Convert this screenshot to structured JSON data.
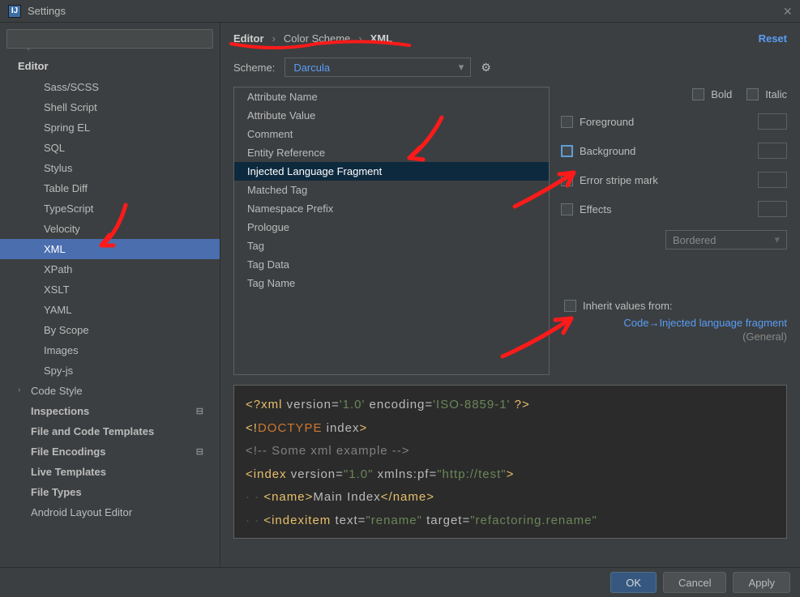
{
  "window": {
    "title": "Settings"
  },
  "search": {
    "placeholder": ""
  },
  "sidebar": {
    "header": "Editor",
    "items": [
      {
        "label": "Sass/SCSS",
        "level": 2
      },
      {
        "label": "Shell Script",
        "level": 2
      },
      {
        "label": "Spring EL",
        "level": 2
      },
      {
        "label": "SQL",
        "level": 2
      },
      {
        "label": "Stylus",
        "level": 2
      },
      {
        "label": "Table Diff",
        "level": 2
      },
      {
        "label": "TypeScript",
        "level": 2
      },
      {
        "label": "Velocity",
        "level": 2
      },
      {
        "label": "XML",
        "level": 2,
        "selected": true
      },
      {
        "label": "XPath",
        "level": 2
      },
      {
        "label": "XSLT",
        "level": 2
      },
      {
        "label": "YAML",
        "level": 2
      },
      {
        "label": "By Scope",
        "level": 2
      },
      {
        "label": "Images",
        "level": 2
      },
      {
        "label": "Spy-js",
        "level": 2
      },
      {
        "label": "Code Style",
        "level": 1,
        "chevron": true
      },
      {
        "label": "Inspections",
        "level": 1,
        "bold": true,
        "gear": true
      },
      {
        "label": "File and Code Templates",
        "level": 1,
        "bold": true
      },
      {
        "label": "File Encodings",
        "level": 1,
        "bold": true,
        "gear": true
      },
      {
        "label": "Live Templates",
        "level": 1,
        "bold": true
      },
      {
        "label": "File Types",
        "level": 1,
        "bold": true
      },
      {
        "label": "Android Layout Editor",
        "level": 1
      }
    ]
  },
  "breadcrumb": {
    "a": "Editor",
    "b": "Color Scheme",
    "c": "XML",
    "reset": "Reset"
  },
  "scheme": {
    "label": "Scheme:",
    "value": "Darcula"
  },
  "attributes": [
    "Attribute Name",
    "Attribute Value",
    "Comment",
    "Entity Reference",
    "Injected Language Fragment",
    "Matched Tag",
    "Namespace Prefix",
    "Prologue",
    "Tag",
    "Tag Data",
    "Tag Name"
  ],
  "attributes_selected": 4,
  "options": {
    "bold": "Bold",
    "italic": "Italic",
    "foreground": "Foreground",
    "background": "Background",
    "error_stripe": "Error stripe mark",
    "effects": "Effects",
    "effects_type": "Bordered",
    "inherit_label": "Inherit values from:",
    "inherit_link": "Code→Injected language fragment",
    "inherit_sub": "(General)"
  },
  "preview": {
    "l1_a": "<?",
    "l1_b": "xml ",
    "l1_c": "version",
    "l1_d": "=",
    "l1_e": "'1.0'",
    "l1_f": " encoding",
    "l1_g": "=",
    "l1_h": "'ISO-8859-1'",
    "l1_i": "  ?>",
    "l2_a": "<!",
    "l2_b": "DOCTYPE ",
    "l2_c": "index",
    "l2_d": ">",
    "l3": "<!-- Some xml example -->",
    "l4_a": "<",
    "l4_b": "index ",
    "l4_c": "version",
    "l4_d": "=",
    "l4_e": "\"1.0\"",
    "l4_f": " xmlns:pf",
    "l4_g": "=",
    "l4_h": "\"http://test\"",
    "l4_i": ">",
    "l5_ws": "· · ",
    "l5_a": "<",
    "l5_b": "name",
    "l5_c": ">",
    "l5_d": "Main Index",
    "l5_e": "</",
    "l5_f": "name",
    "l5_g": ">",
    "l6_ws": "· · ",
    "l6_a": "<",
    "l6_b": "indexitem ",
    "l6_c": "text",
    "l6_d": "=",
    "l6_e": "\"rename\"",
    "l6_f": " target",
    "l6_g": "=",
    "l6_h": "\"refactoring.rename\""
  },
  "buttons": {
    "ok": "OK",
    "cancel": "Cancel",
    "apply": "Apply"
  }
}
